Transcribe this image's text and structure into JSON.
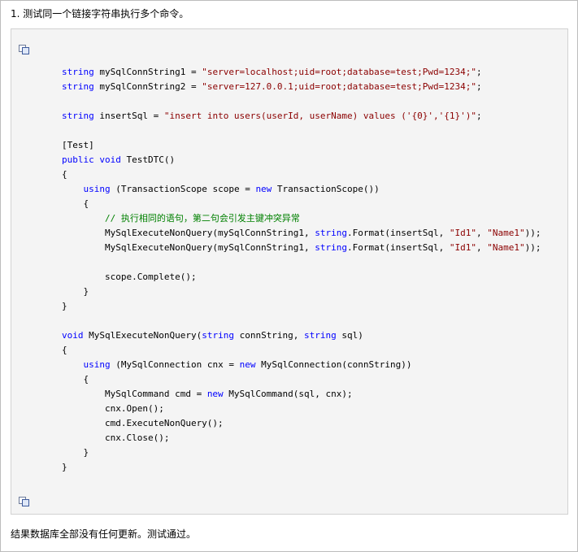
{
  "intro_text": "1. 测试同一个链接字符串执行多个命令。",
  "outro_text": "结果数据库全部没有任何更新。测试通过。",
  "icons": {
    "copy_top": "copy-icon",
    "copy_bottom": "copy-icon"
  },
  "colors": {
    "keyword": "#0000ff",
    "string": "#8b0000",
    "comment": "#008000",
    "code_background": "#f4f4f4"
  },
  "code_lines": [
    [
      [
        "kw",
        "string"
      ],
      [
        "tx",
        " mySqlConnString1 = "
      ],
      [
        "str",
        "\"server=localhost;uid=root;database=test;Pwd=1234;\""
      ],
      [
        "tx",
        ";"
      ]
    ],
    [
      [
        "kw",
        "string"
      ],
      [
        "tx",
        " mySqlConnString2 = "
      ],
      [
        "str",
        "\"server=127.0.0.1;uid=root;database=test;Pwd=1234;\""
      ],
      [
        "tx",
        ";"
      ]
    ],
    [],
    [
      [
        "kw",
        "string"
      ],
      [
        "tx",
        " insertSql = "
      ],
      [
        "str",
        "\"insert into users(userId, userName) values ('{0}','{1}')\""
      ],
      [
        "tx",
        ";"
      ]
    ],
    [],
    [
      [
        "tx",
        "[Test]"
      ]
    ],
    [
      [
        "kw",
        "public"
      ],
      [
        "tx",
        " "
      ],
      [
        "kw",
        "void"
      ],
      [
        "tx",
        " TestDTC()"
      ]
    ],
    [
      [
        "tx",
        "{"
      ]
    ],
    [
      [
        "tx",
        "    "
      ],
      [
        "kw",
        "using"
      ],
      [
        "tx",
        " (TransactionScope scope = "
      ],
      [
        "kw",
        "new"
      ],
      [
        "tx",
        " TransactionScope())"
      ]
    ],
    [
      [
        "tx",
        "    {"
      ]
    ],
    [
      [
        "tx",
        "        "
      ],
      [
        "cm",
        "// 执行相同的语句，第二句会引发主键冲突异常"
      ]
    ],
    [
      [
        "tx",
        "        MySqlExecuteNonQuery(mySqlConnString1, "
      ],
      [
        "kw",
        "string"
      ],
      [
        "tx",
        ".Format(insertSql, "
      ],
      [
        "str",
        "\"Id1\""
      ],
      [
        "tx",
        ", "
      ],
      [
        "str",
        "\"Name1\""
      ],
      [
        "tx",
        "));"
      ]
    ],
    [
      [
        "tx",
        "        MySqlExecuteNonQuery(mySqlConnString1, "
      ],
      [
        "kw",
        "string"
      ],
      [
        "tx",
        ".Format(insertSql, "
      ],
      [
        "str",
        "\"Id1\""
      ],
      [
        "tx",
        ", "
      ],
      [
        "str",
        "\"Name1\""
      ],
      [
        "tx",
        "));"
      ]
    ],
    [],
    [
      [
        "tx",
        "        scope.Complete();"
      ]
    ],
    [
      [
        "tx",
        "    }"
      ]
    ],
    [
      [
        "tx",
        "}"
      ]
    ],
    [],
    [
      [
        "kw",
        "void"
      ],
      [
        "tx",
        " MySqlExecuteNonQuery("
      ],
      [
        "kw",
        "string"
      ],
      [
        "tx",
        " connString, "
      ],
      [
        "kw",
        "string"
      ],
      [
        "tx",
        " sql)"
      ]
    ],
    [
      [
        "tx",
        "{"
      ]
    ],
    [
      [
        "tx",
        "    "
      ],
      [
        "kw",
        "using"
      ],
      [
        "tx",
        " (MySqlConnection cnx = "
      ],
      [
        "kw",
        "new"
      ],
      [
        "tx",
        " MySqlConnection(connString))"
      ]
    ],
    [
      [
        "tx",
        "    {"
      ]
    ],
    [
      [
        "tx",
        "        MySqlCommand cmd = "
      ],
      [
        "kw",
        "new"
      ],
      [
        "tx",
        " MySqlCommand(sql, cnx);"
      ]
    ],
    [
      [
        "tx",
        "        cnx.Open();"
      ]
    ],
    [
      [
        "tx",
        "        cmd.ExecuteNonQuery();"
      ]
    ],
    [
      [
        "tx",
        "        cnx.Close();"
      ]
    ],
    [
      [
        "tx",
        "    }"
      ]
    ],
    [
      [
        "tx",
        "}"
      ]
    ]
  ]
}
